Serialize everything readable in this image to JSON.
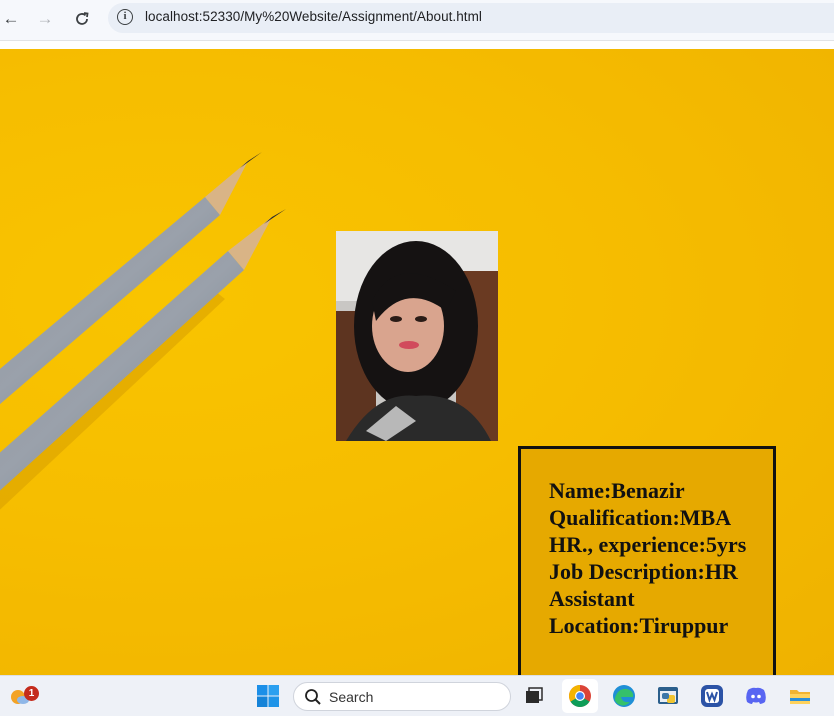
{
  "browser": {
    "url": "localhost:52330/My%20Website/Assignment/About.html",
    "back_icon": "arrow-left-icon",
    "forward_icon": "arrow-right-icon",
    "reload_icon": "reload-icon",
    "info_icon": "info-icon"
  },
  "page": {
    "background_color": "#f6bd00",
    "photo_alt": "profile-photo",
    "info_lines": "Name:Benazir Qualification:MBA HR., experience:5yrs Job Description:HR Assistant Location:Tiruppur"
  },
  "taskbar": {
    "search_placeholder": "Search",
    "weather_badge": "1",
    "apps": [
      "start-icon",
      "task-view-icon",
      "chrome-icon",
      "edge-icon",
      "python-idle-icon",
      "webex-icon",
      "discord-icon",
      "file-explorer-icon"
    ]
  }
}
